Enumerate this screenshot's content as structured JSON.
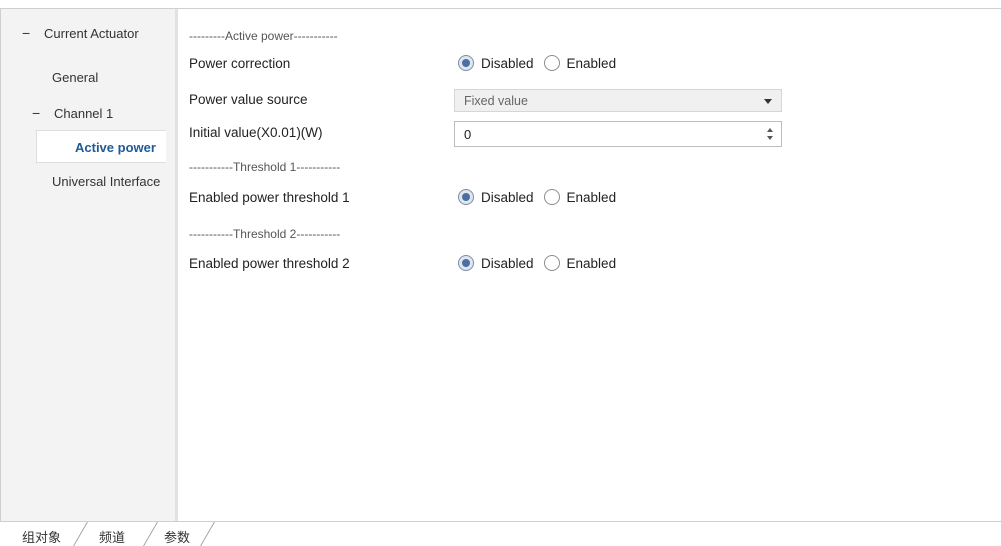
{
  "sidebar": {
    "root": {
      "toggle": "−",
      "label": "Current Actuator"
    },
    "items": [
      {
        "label": "General"
      },
      {
        "toggle": "−",
        "label": "Channel 1"
      },
      {
        "label": "Active power"
      },
      {
        "label": "Universal Interface"
      }
    ]
  },
  "main": {
    "section_active_power": "---------Active power-----------",
    "power_correction": {
      "label": "Power correction",
      "options": [
        "Disabled",
        "Enabled"
      ],
      "selected": "Disabled"
    },
    "power_value_source": {
      "label": "Power value source",
      "value": "Fixed value"
    },
    "initial_value": {
      "label": "Initial value(X0.01)(W)",
      "value": "0"
    },
    "section_threshold1": "-----------Threshold 1-----------",
    "threshold1": {
      "label": "Enabled power threshold 1",
      "options": [
        "Disabled",
        "Enabled"
      ],
      "selected": "Disabled"
    },
    "section_threshold2": "-----------Threshold 2-----------",
    "threshold2": {
      "label": "Enabled power threshold 2",
      "options": [
        "Disabled",
        "Enabled"
      ],
      "selected": "Disabled"
    }
  },
  "tabs": [
    {
      "label": "组对象"
    },
    {
      "label": "频道"
    },
    {
      "label": "参数",
      "active": true
    }
  ],
  "colors": {
    "selected_tree_text": "#1f5a96",
    "radio_checked": "#4a6fa0",
    "sidebar_bg": "#f3f3f3"
  }
}
